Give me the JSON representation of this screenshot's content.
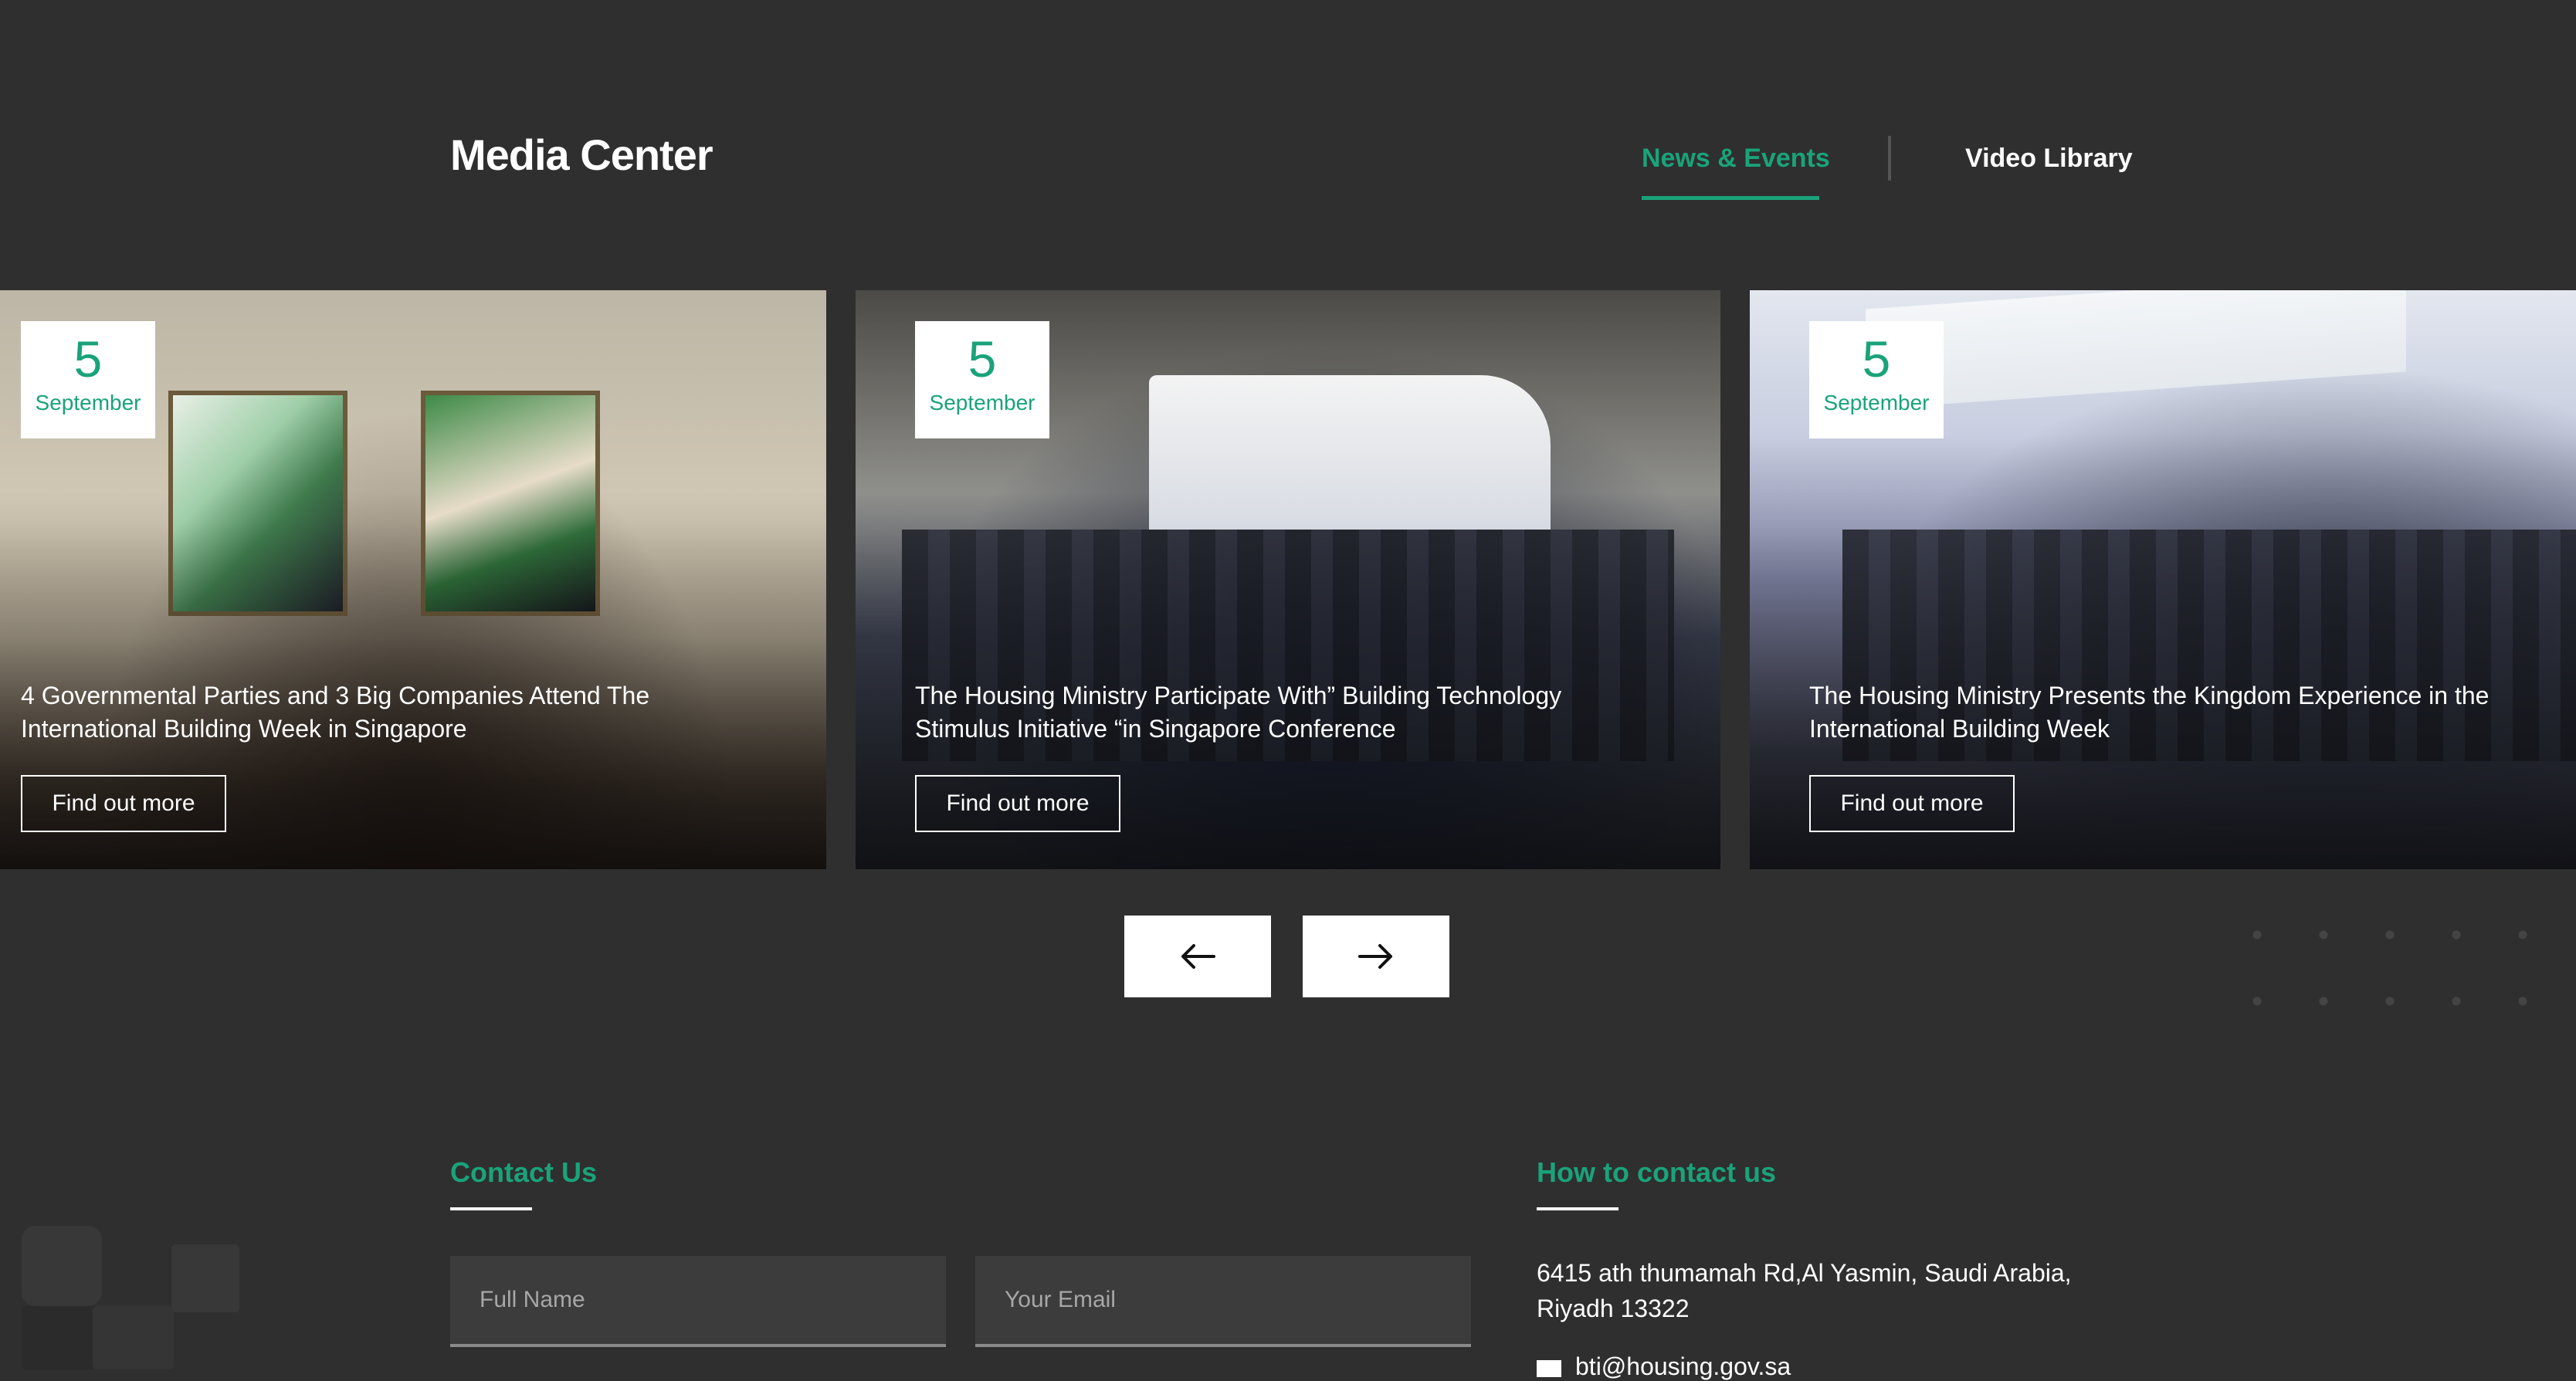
{
  "header": {
    "title": "Media Center",
    "tabs": [
      {
        "label": "News & Events",
        "active": true
      },
      {
        "label": "Video Library",
        "active": false
      }
    ]
  },
  "cards": [
    {
      "day": "5",
      "month": "September",
      "title_line1": "4 Governmental Parties and 3 Big Companies Attend The",
      "title_line2": "International Building Week in Singapore",
      "button": "Find out more"
    },
    {
      "day": "5",
      "month": "September",
      "title_line1": "The Housing Ministry Participate With” Building Technology",
      "title_line2": "Stimulus Initiative “in Singapore Conference",
      "button": "Find out more"
    },
    {
      "day": "5",
      "month": "September",
      "title_line1": "The Housing Ministry Presents the Kingdom Experience in the",
      "title_line2": "International Building Week",
      "button": "Find out more"
    }
  ],
  "carousel": {
    "prev_icon": "arrow-left-icon",
    "next_icon": "arrow-right-icon"
  },
  "contact_form": {
    "heading": "Contact Us",
    "full_name_placeholder": "Full Name",
    "email_placeholder": "Your Email"
  },
  "contact_info": {
    "heading": "How to contact us",
    "address_line1": "6415 ath thumamah Rd,Al Yasmin, Saudi Arabia,",
    "address_line2": "Riyadh 13322",
    "email": "bti@housing.gov.sa"
  },
  "colors": {
    "background": "#2f2f2f",
    "accent": "#1aa37a",
    "text": "#ffffff"
  }
}
